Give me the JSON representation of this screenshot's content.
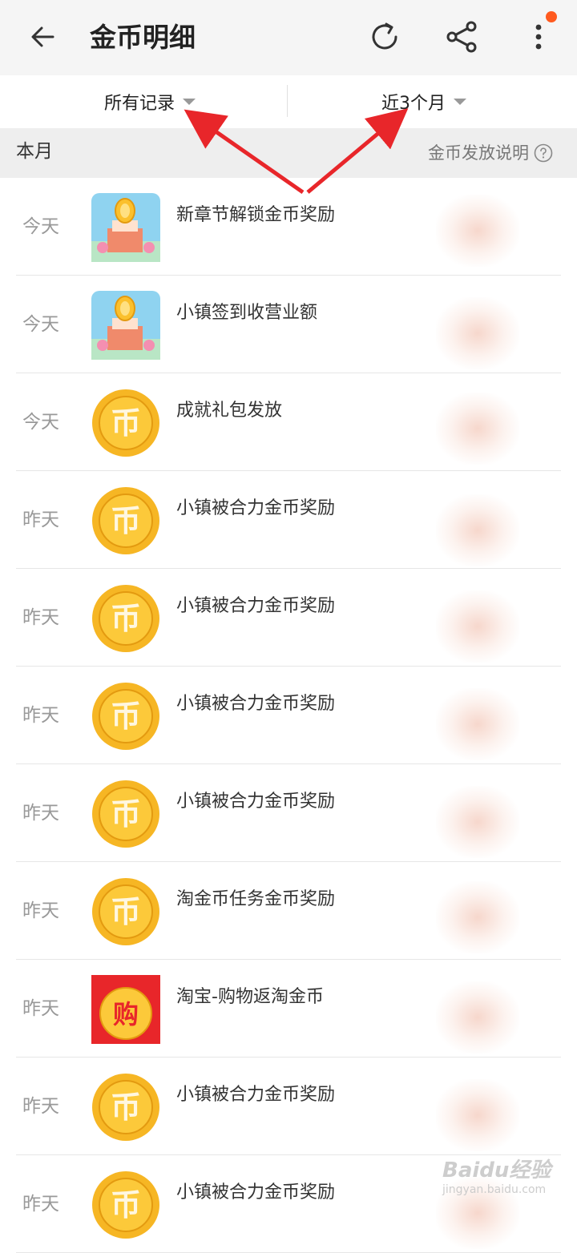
{
  "header": {
    "title": "金币明细"
  },
  "filters": {
    "left_label": "所有记录",
    "right_label": "近3个月"
  },
  "section": {
    "month_label": "本月",
    "explain_label": "金币发放说明"
  },
  "icons": {
    "coin_glyph": "币",
    "buy_glyph": "购"
  },
  "rows": [
    {
      "day": "今天",
      "name": "新章节解锁金币奖励",
      "icon": "town-icon"
    },
    {
      "day": "今天",
      "name": "小镇签到收营业额",
      "icon": "town-icon"
    },
    {
      "day": "今天",
      "name": "成就礼包发放",
      "icon": "coin-icon"
    },
    {
      "day": "昨天",
      "name": "小镇被合力金币奖励",
      "icon": "coin-icon"
    },
    {
      "day": "昨天",
      "name": "小镇被合力金币奖励",
      "icon": "coin-icon"
    },
    {
      "day": "昨天",
      "name": "小镇被合力金币奖励",
      "icon": "coin-icon"
    },
    {
      "day": "昨天",
      "name": "小镇被合力金币奖励",
      "icon": "coin-icon"
    },
    {
      "day": "昨天",
      "name": "淘金币任务金币奖励",
      "icon": "coin-icon"
    },
    {
      "day": "昨天",
      "name": "淘宝-购物返淘金币",
      "icon": "buy-icon"
    },
    {
      "day": "昨天",
      "name": "小镇被合力金币奖励",
      "icon": "coin-icon"
    },
    {
      "day": "昨天",
      "name": "小镇被合力金币奖励",
      "icon": "coin-icon"
    }
  ],
  "watermark": {
    "brand": "Baidu经验",
    "url": "jingyan.baidu.com"
  },
  "colors": {
    "accent_dot": "#ff5a1f",
    "arrow_red": "#e8262a",
    "coin_gold": "#f7b928"
  }
}
